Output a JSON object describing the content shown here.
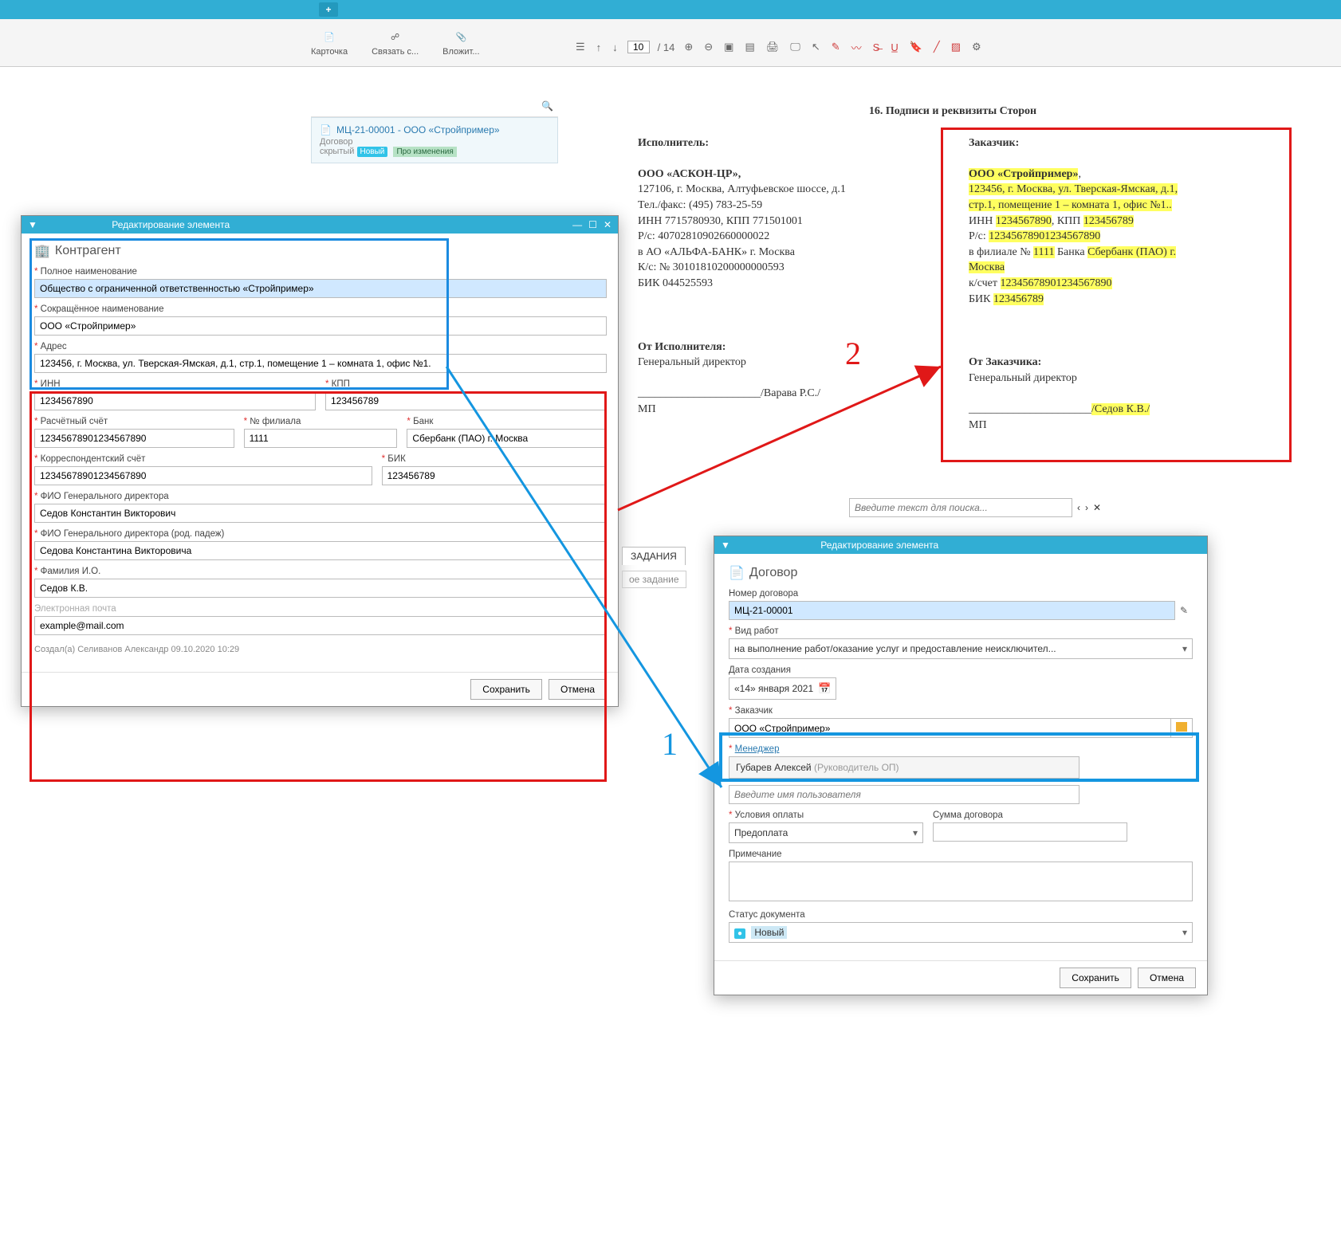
{
  "top": {
    "plus": "+"
  },
  "toolbar": {
    "card": "Карточка",
    "link": "Связать с...",
    "attach": "Вложит..."
  },
  "docbar": {
    "page": "10",
    "pages": "/ 14"
  },
  "leftcard": {
    "title": "МЦ-21-00001 - ООО «Стройпример»",
    "sub1": "Договор",
    "sub2": "скрытый",
    "new": "Новый",
    "chg": "Про изменения"
  },
  "dialogTitle": "Редактирование элемента",
  "ctr": {
    "head": "Контрагент",
    "fullLbl": "Полное наименование",
    "fullVal": "Общество с ограниченной ответственностью «Стройпример»",
    "shortLbl": "Сокращённое наименование",
    "shortVal": "ООО «Стройпример»",
    "addrLbl": "Адрес",
    "addrVal": "123456, г. Москва, ул. Тверская-Ямская, д.1, стр.1, помещение 1 – комната 1, офис №1.",
    "innLbl": "ИНН",
    "innVal": "1234567890",
    "kppLbl": "КПП",
    "kppVal": "123456789",
    "acctLbl": "Расчётный счёт",
    "acctVal": "12345678901234567890",
    "branchLbl": "№ филиала",
    "branchVal": "1111",
    "bankLbl": "Банк",
    "bankVal": "Сбербанк (ПАО) г. Москва",
    "corrLbl": "Корреспондентский счёт",
    "corrVal": "12345678901234567890",
    "bicLbl": "БИК",
    "bicVal": "123456789",
    "fioLbl": "ФИО Генерального директора",
    "fioVal": "Седов Константин Викторович",
    "fioGenLbl": "ФИО Генерального директора (род. падеж)",
    "fioGenVal": "Седова Константина Викторовича",
    "famLbl": "Фамилия И.О.",
    "famVal": "Седов К.В.",
    "emailLbl": "Электронная почта",
    "emailVal": "example@mail.com",
    "created": "Создал(а) Селиванов Александр 09.10.2020 10:29",
    "save": "Сохранить",
    "cancel": "Отмена"
  },
  "doc": {
    "heading": "16. Подписи и реквизиты Сторон",
    "execLabel": "Исполнитель:",
    "custLabel": "Заказчик:",
    "exec": {
      "name": "ООО «АСКОН-ЦР»,",
      "addr": "127106, г. Москва, Алтуфьевское шоссе, д.1",
      "phone": "Тел./факс: (495) 783-25-59",
      "innkpp": "ИНН 7715780930, КПП 771501001",
      "rs": "Р/с: 40702810902660000022",
      "bank": "в АО «АЛЬФА-БАНК» г. Москва",
      "ks": "К/с: № 30101810200000000593",
      "bic": "БИК 044525593",
      "fromLbl": "От Исполнителя:",
      "pos": "Генеральный директор",
      "sign": "/Варава Р.С./",
      "mp": "МП"
    },
    "cust": {
      "name": "ООО «Стройпример»",
      "addr1": "123456, г. Москва, ул. Тверская-Ямская, д.1,",
      "addr2": "стр.1, помещение 1 – комната 1, офис №1..",
      "innkpp_pre": "ИНН ",
      "inn": "1234567890",
      "kpp_pre": ", КПП ",
      "kpp": "123456789",
      "rs_pre": "Р/с: ",
      "rs": "12345678901234567890",
      "bank_pre1": "в филиале № ",
      "branch": "1111",
      "bank_pre2": " Банка ",
      "bank": "Сбербанк (ПАО) г.",
      "bank_city": "Москва",
      "ks_pre": "к/счет ",
      "ks": "12345678901234567890",
      "bic_pre": "БИК ",
      "bic": "123456789",
      "fromLbl": "От Заказчика:",
      "pos": "Генеральный директор",
      "sign": "/Седов К.В./",
      "mp": "МП"
    }
  },
  "search": {
    "ph": "Введите текст для поиска..."
  },
  "tabs": {
    "tasks": "ЗАДАНИЯ",
    "newtask": "ое задание"
  },
  "dog": {
    "head": "Договор",
    "numLbl": "Номер договора",
    "numVal": "МЦ-21-00001",
    "workLbl": "Вид работ",
    "workVal": "на выполнение работ/оказание услуг и предоставление неисключител...",
    "dateLbl": "Дата создания",
    "dateVal": "«14» января 2021",
    "custLbl": "Заказчик",
    "custVal": "ООО «Стройпример»",
    "mgrLbl": "Менеджер",
    "mgrName": "Губарев Алексей",
    "mgrRole": "(Руководитель ОП)",
    "mgrPh": "Введите имя пользователя",
    "payLbl": "Условия оплаты",
    "payVal": "Предоплата",
    "sumLbl": "Сумма договора",
    "noteLbl": "Примечание",
    "statusLbl": "Статус документа",
    "statusVal": "Новый",
    "save": "Сохранить",
    "cancel": "Отмена"
  },
  "numbers": {
    "one": "1",
    "two": "2"
  }
}
